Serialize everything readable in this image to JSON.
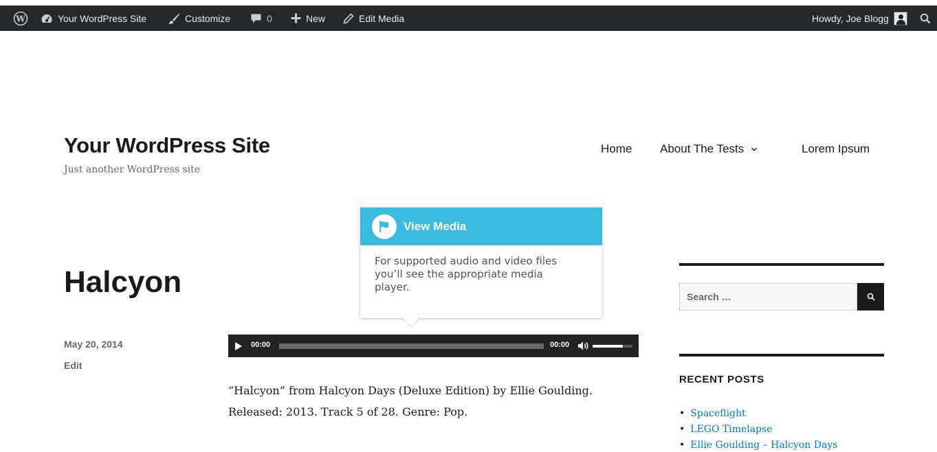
{
  "adminbar": {
    "site_name": "Your WordPress Site",
    "customize": "Customize",
    "comments_count": "0",
    "new": "New",
    "edit_media": "Edit Media",
    "howdy": "Howdy, Joe Blogg"
  },
  "site": {
    "title": "Your WordPress Site",
    "description": "Just another WordPress site"
  },
  "nav": {
    "items": [
      "Home",
      "About The Tests",
      "Lorem Ipsum"
    ]
  },
  "post": {
    "title": "Halcyon",
    "date": "May 20, 2014",
    "edit": "Edit",
    "body_line1": "“Halcyon” from Halcyon Days (Deluxe Edition) by Ellie Goulding.",
    "body_line2": "Released: 2013. Track 5 of 28. Genre: Pop."
  },
  "player": {
    "current_time": "00:00",
    "duration": "00:00",
    "volume_level": 0.75
  },
  "tooltip": {
    "title": "View Media",
    "body": "For supported audio and video files you’ll see the appropriate media player."
  },
  "sidebar": {
    "search_placeholder": "Search …",
    "recent_posts_heading": "RECENT POSTS",
    "recent_posts": [
      "Spaceflight",
      "LEGO Timelapse",
      "Ellie Goulding – Halcyon Days"
    ]
  },
  "colors": {
    "adminbar_bg": "#23282d",
    "tooltip_accent": "#3bbbe0",
    "link": "#007acc",
    "player_bg": "#222222"
  },
  "icons": {
    "wordpress_logo": "wordpress-logo-icon",
    "dashboard": "dashboard-icon",
    "customize": "paintbrush-icon",
    "comments": "comment-bubble-icon",
    "new": "plus-icon",
    "edit": "pencil-icon",
    "search": "search-icon",
    "play": "play-icon",
    "volume": "volume-icon",
    "flag": "flag-icon"
  }
}
